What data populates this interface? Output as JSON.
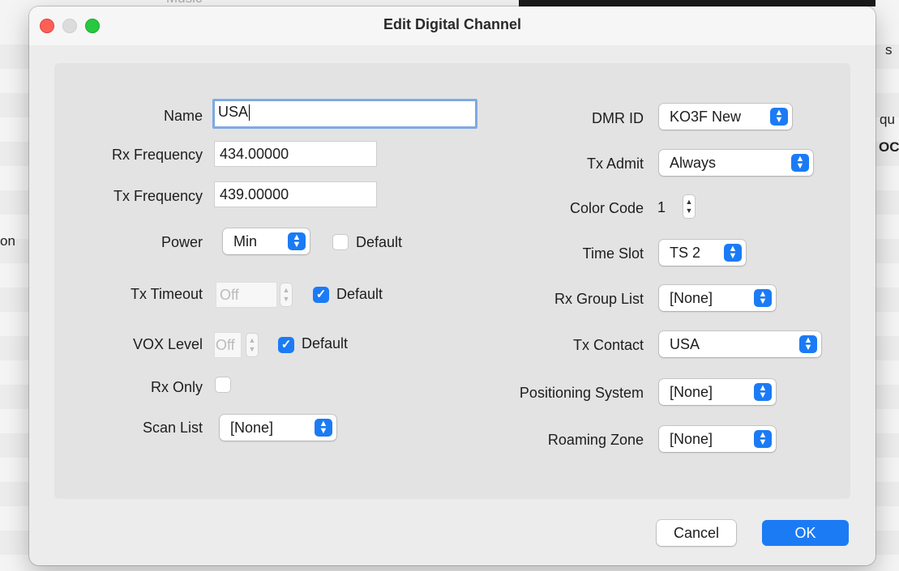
{
  "background": {
    "menu_text": "Music",
    "right_text_1": "s",
    "right_text_2": "qu",
    "right_text_3": "OC",
    "left_text": "on"
  },
  "dialog": {
    "title": "Edit Digital Channel",
    "colors": {
      "accent": "#1b7bf5",
      "close": "#fe5f57",
      "zoom": "#28c840"
    }
  },
  "left": {
    "name": {
      "label": "Name",
      "value": "USA"
    },
    "rx_frequency": {
      "label": "Rx Frequency",
      "value": "434.00000"
    },
    "tx_frequency": {
      "label": "Tx Frequency",
      "value": "439.00000"
    },
    "power": {
      "label": "Power",
      "value": "Min",
      "default_label": "Default",
      "default_checked": false
    },
    "tx_timeout": {
      "label": "Tx Timeout",
      "value": "Off",
      "default_label": "Default",
      "default_checked": true
    },
    "vox_level": {
      "label": "VOX Level",
      "value": "Off",
      "default_label": "Default",
      "default_checked": true
    },
    "rx_only": {
      "label": "Rx Only",
      "checked": false
    },
    "scan_list": {
      "label": "Scan List",
      "value": "[None]"
    }
  },
  "right": {
    "dmr_id": {
      "label": "DMR ID",
      "value": "KO3F New"
    },
    "tx_admit": {
      "label": "Tx Admit",
      "value": "Always"
    },
    "color_code": {
      "label": "Color Code",
      "value": "1"
    },
    "time_slot": {
      "label": "Time Slot",
      "value": "TS 2"
    },
    "rx_group_list": {
      "label": "Rx Group List",
      "value": "[None]"
    },
    "tx_contact": {
      "label": "Tx Contact",
      "value": "USA"
    },
    "positioning_system": {
      "label": "Positioning System",
      "value": "[None]"
    },
    "roaming_zone": {
      "label": "Roaming Zone",
      "value": "[None]"
    }
  },
  "buttons": {
    "cancel": "Cancel",
    "ok": "OK"
  }
}
